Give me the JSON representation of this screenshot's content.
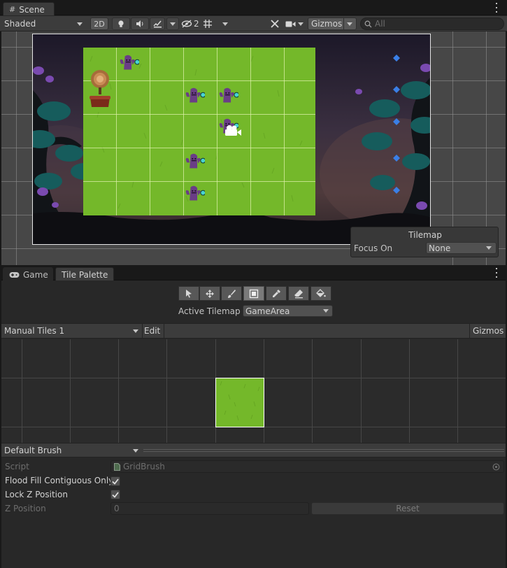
{
  "scene_tab": {
    "label": "Scene",
    "icon": "grid-icon"
  },
  "scene_toolbar": {
    "draw_mode": "Shaded",
    "mode_2d": "2D",
    "hidden_count": "2",
    "gizmos": "Gizmos",
    "search_placeholder": "All"
  },
  "tilemap_overlay": {
    "title": "Tilemap",
    "focus_on_label": "Focus On",
    "focus_on_value": "None"
  },
  "bottom_tabs": [
    {
      "label": "Game",
      "icon": "gamepad-icon"
    },
    {
      "label": "Tile Palette"
    }
  ],
  "palette": {
    "tools": [
      "select-icon",
      "move-icon",
      "paint-icon",
      "box-fill-icon",
      "picker-icon",
      "eraser-icon",
      "fill-icon"
    ],
    "active_tool_index": 3,
    "active_tilemap_label": "Active Tilemap",
    "active_tilemap_value": "GameArea",
    "palette_name": "Manual Tiles 1",
    "edit_label": "Edit",
    "gizmos_label": "Gizmos"
  },
  "brush": {
    "brush_name": "Default Brush",
    "script_label": "Script",
    "script_value": "GridBrush",
    "flood_fill_label": "Flood Fill Contiguous Only",
    "flood_fill_checked": true,
    "lock_z_label": "Lock Z Position",
    "lock_z_checked": true,
    "z_position_label": "Z Position",
    "z_position_value": "0",
    "reset_label": "Reset"
  }
}
